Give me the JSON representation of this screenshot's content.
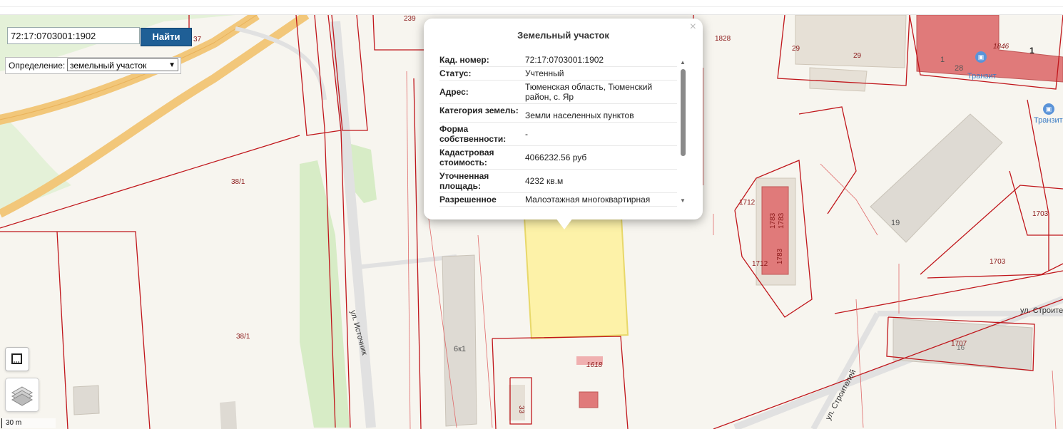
{
  "search": {
    "value": "72:17:0703001:1902",
    "button": "Найти"
  },
  "definition": {
    "label": "Определение:",
    "selected": "земельный участок"
  },
  "scale": "30 m",
  "popup": {
    "title": "Земельный участок",
    "close": "×",
    "rows": [
      {
        "k": "Кад. номер:",
        "v": "72:17:0703001:1902"
      },
      {
        "k": "Статус:",
        "v": "Учтенный"
      },
      {
        "k": "Адрес:",
        "v": "Тюменская область, Тюменский район, с. Яр"
      },
      {
        "k": "Категория земель:",
        "v": "Земли населенных пунктов"
      },
      {
        "k": "Форма собственности:",
        "v": "-"
      },
      {
        "k": "Кадастровая стоимость:",
        "v": "4066232.56 руб"
      },
      {
        "k": "Уточненная площадь:",
        "v": "4232 кв.м"
      },
      {
        "k": "Разрешенное",
        "v": "Малоэтажная многоквартирная"
      }
    ]
  },
  "map_labels": {
    "l37": "37",
    "l239": "239",
    "l1828": "1828",
    "l29a": "29",
    "l29b": "29",
    "l1": "1",
    "l28": "28",
    "l1846": "1846",
    "l1big": "1",
    "l38_1a": "38/1",
    "l38_1b": "38/1",
    "l1712a": "1712",
    "l1712b": "1712",
    "l1783a": "1783",
    "l1783b": "1783",
    "l1783c": "1783",
    "l1703a": "1703",
    "l1703b": "1703",
    "l19": "19",
    "l1707": "1707",
    "l16": "16",
    "l1618": "1618",
    "l6k1": "6к1",
    "l33": "33"
  },
  "streets": {
    "istochnik": "ул. Источник",
    "stroitelei": "ул. Строителей",
    "stroit_e": "ул. Строите"
  },
  "poi": {
    "transit1": "Транзит",
    "transit2": "Транзит"
  }
}
